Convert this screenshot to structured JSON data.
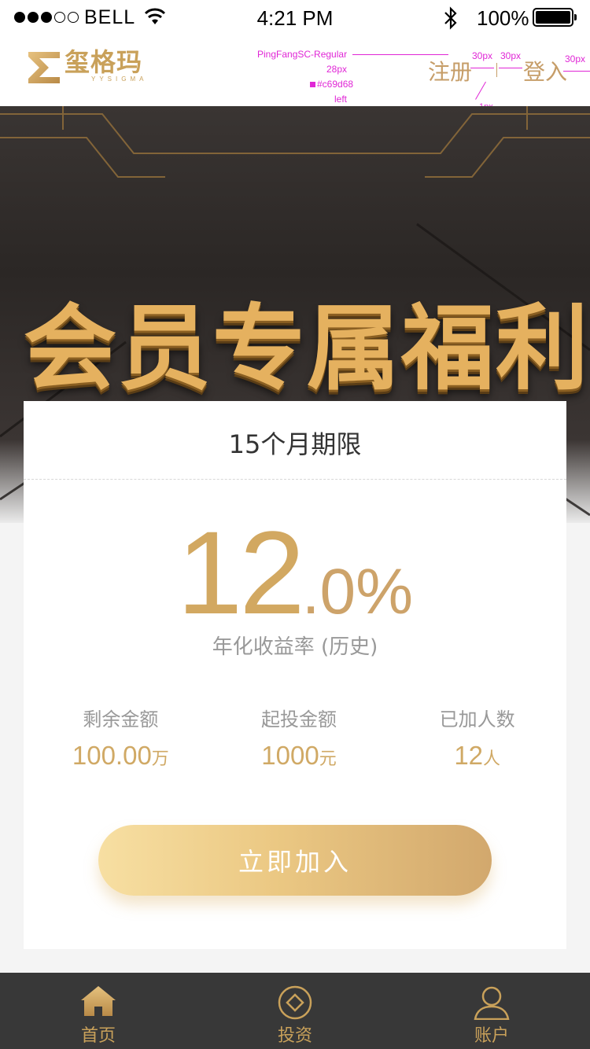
{
  "status_bar": {
    "carrier": "BELL",
    "time": "4:21 PM",
    "battery": "100%"
  },
  "header": {
    "logo_cn": "玺格玛",
    "logo_en": "YYSIGMA",
    "register_label": "注册",
    "login_label": "登入"
  },
  "annotations": {
    "font": "PingFangSC-Regular",
    "size": "28px",
    "color": "#c69d68",
    "align": "left",
    "gap_1": "30px",
    "gap_2": "30px",
    "gap_3": "30px",
    "divider": "1px"
  },
  "banner": {
    "title": "会员专属福利",
    "slides": 3,
    "active_slide": 0
  },
  "product": {
    "period": "15个月期限",
    "rate_integer": "12",
    "rate_decimal": ".0%",
    "rate_label": "年化收益率 (历史)",
    "stats": [
      {
        "label": "剩余金额",
        "value": "100.00",
        "unit": "万"
      },
      {
        "label": "起投金额",
        "value": "1000",
        "unit": "元"
      },
      {
        "label": "已加人数",
        "value": "12",
        "unit": "人"
      }
    ],
    "join_button": "立即加入"
  },
  "tabbar": {
    "items": [
      {
        "label": "首页",
        "icon": "home-icon"
      },
      {
        "label": "投资",
        "icon": "invest-icon"
      },
      {
        "label": "账户",
        "icon": "account-icon"
      }
    ]
  },
  "colors": {
    "gold": "#c69d68",
    "tabbar_bg": "#383838",
    "annotation": "#e026d6"
  }
}
